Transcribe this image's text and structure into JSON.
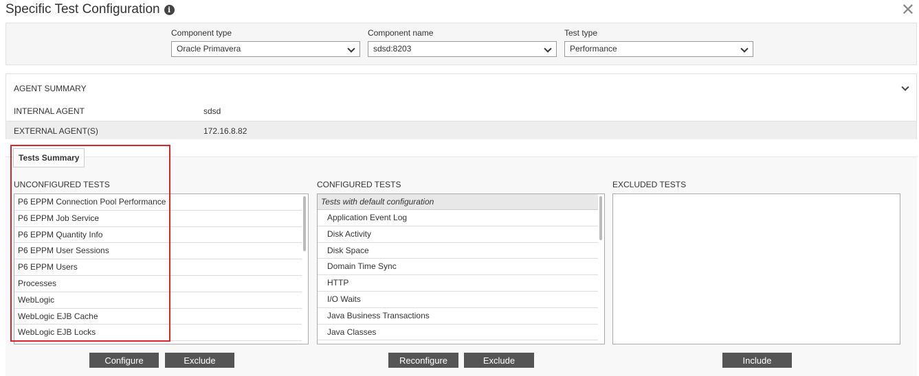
{
  "title": "Specific Test Configuration",
  "icons": {
    "info": "info-icon",
    "close": "close-icon",
    "chevron": "chevron-down-icon"
  },
  "close_glyph": "✕",
  "info_glyph": "i",
  "config": {
    "component_type": {
      "label": "Component type",
      "value": "Oracle Primavera"
    },
    "component_name": {
      "label": "Component name",
      "value": "sdsd:8203"
    },
    "test_type": {
      "label": "Test type",
      "value": "Performance"
    }
  },
  "agent_summary": {
    "header": "AGENT SUMMARY",
    "internal": {
      "label": "INTERNAL AGENT",
      "value": "sdsd"
    },
    "external": {
      "label": "EXTERNAL AGENT(S)",
      "value": "172.16.8.82"
    }
  },
  "tests_summary": {
    "tab": "Tests Summary",
    "unconfigured": {
      "title": "UNCONFIGURED TESTS",
      "items": [
        "P6 EPPM Connection Pool Performance",
        "P6 EPPM Job Service",
        "P6 EPPM Quantity Info",
        "P6 EPPM User Sessions",
        "P6 EPPM Users",
        "Processes",
        "WebLogic",
        "WebLogic EJB Cache",
        "WebLogic EJB Locks"
      ]
    },
    "configured": {
      "title": "CONFIGURED TESTS",
      "group": "Tests with default configuration",
      "items": [
        "Application Event Log",
        "Disk Activity",
        "Disk Space",
        "Domain Time Sync",
        "HTTP",
        "I/O Waits",
        "Java Business Transactions",
        "Java Classes"
      ]
    },
    "excluded": {
      "title": "EXCLUDED TESTS",
      "items": []
    }
  },
  "buttons": {
    "configure": "Configure",
    "exclude_unconfigured": "Exclude",
    "reconfigure": "Reconfigure",
    "exclude_configured": "Exclude",
    "include": "Include"
  },
  "colors": {
    "highlight": "#d9262e",
    "button": "#555555"
  }
}
